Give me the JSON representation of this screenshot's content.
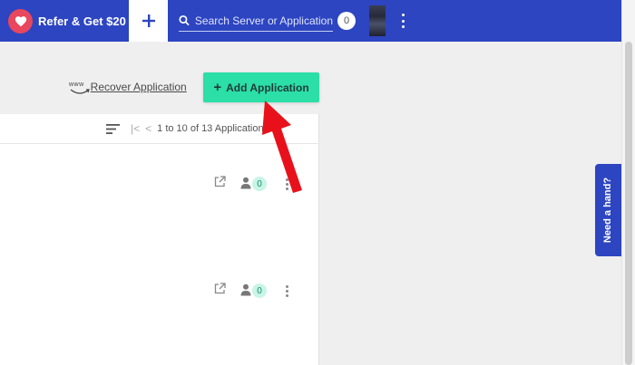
{
  "topbar": {
    "refer_label": "Refer & Get $20",
    "search_placeholder": "Search Server or Application",
    "notification_count": "0"
  },
  "actions": {
    "www_label": "www",
    "recover_label": "Recover Application",
    "add_label": "Add Application",
    "add_button_color": "#2bdfa6"
  },
  "pager": {
    "text": "1 to 10 of 13 Applications",
    "first_icon": "first-page-icon",
    "prev_icon": "prev-page-icon",
    "last_icon": "last-page-icon"
  },
  "rows": [
    {
      "user_count": "0"
    },
    {
      "user_count": "0"
    }
  ],
  "help": {
    "label": "Need a hand?"
  },
  "colors": {
    "brand_blue": "#2d45c1",
    "heart_red": "#e8475e",
    "annotation_red": "#e8111b"
  }
}
